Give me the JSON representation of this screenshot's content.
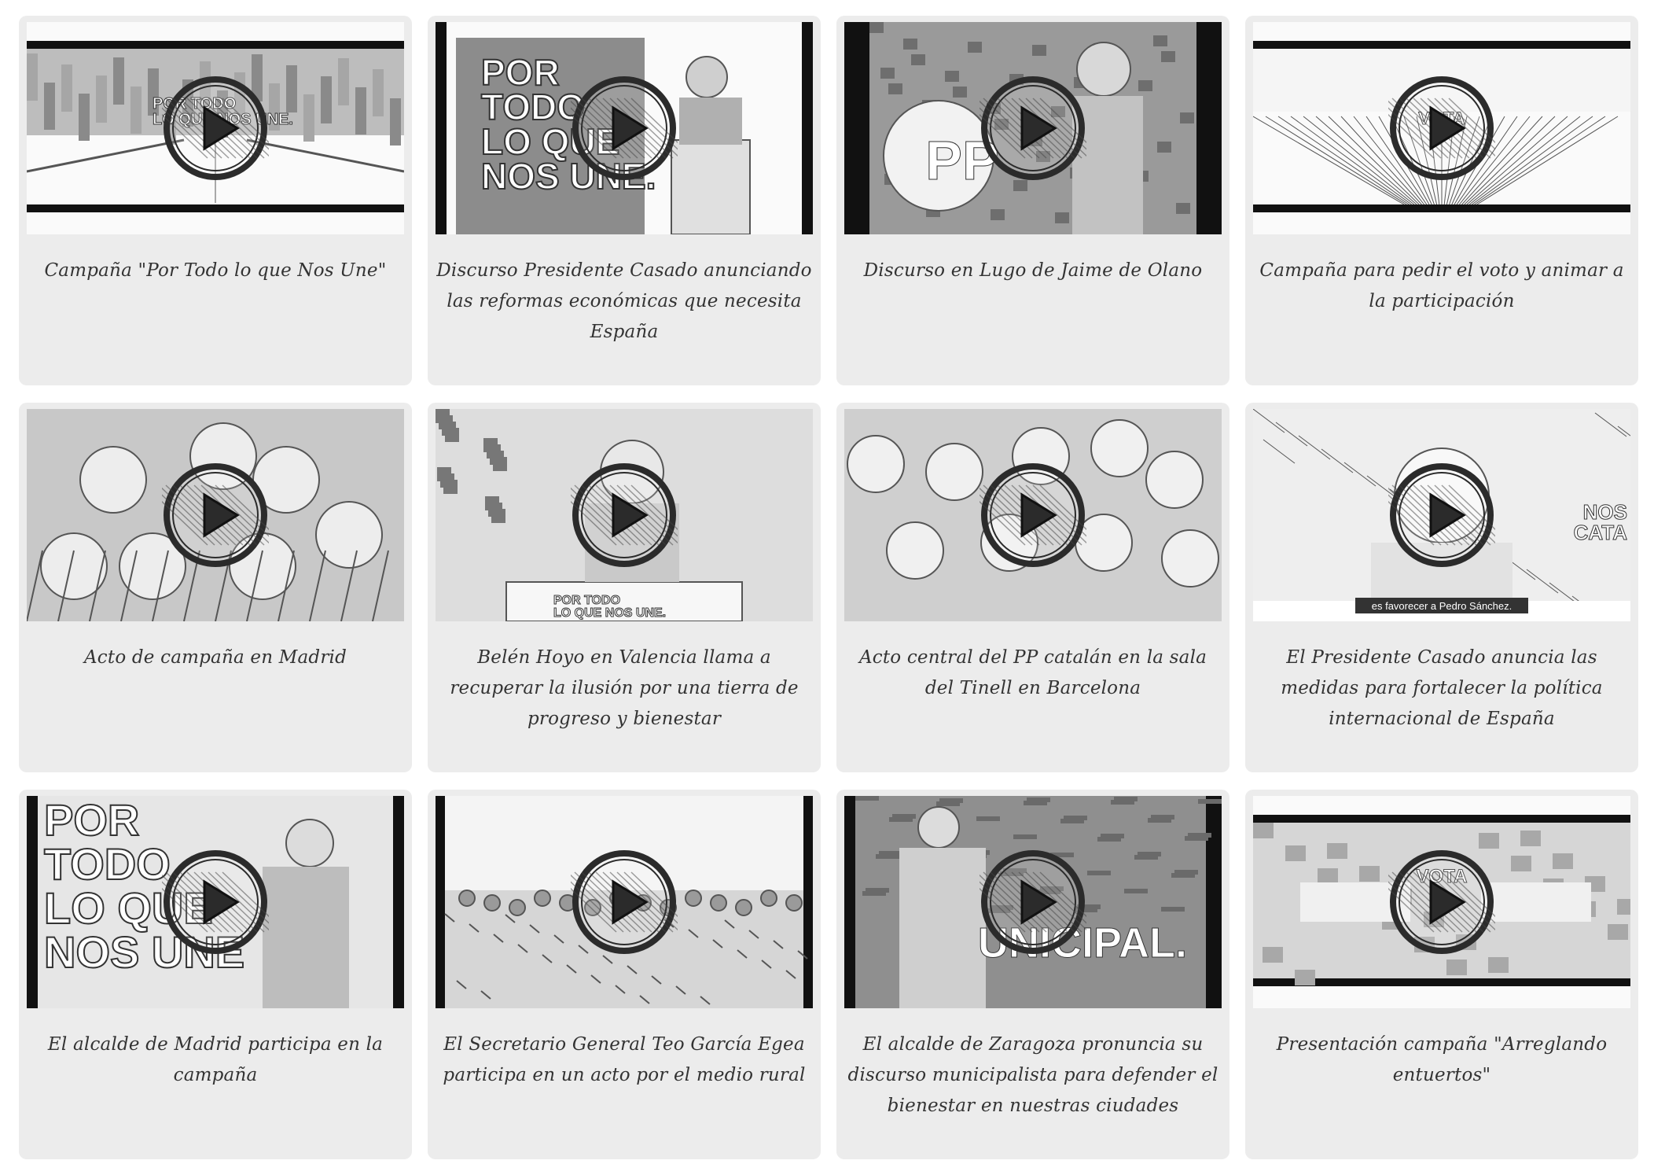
{
  "videos": [
    {
      "caption": "Campaña \"Por Todo lo que Nos Une\"",
      "thumb": "road",
      "overlay": [
        "POR TODO",
        "LO QUE NOS UNE."
      ]
    },
    {
      "caption": "Discurso Presidente Casado anunciando las reformas económicas que necesita España",
      "thumb": "podium",
      "overlay": [
        "POR",
        "TODO",
        "LO QUE",
        "NOS UNE."
      ]
    },
    {
      "caption": "Discurso en Lugo de Jaime de Olano",
      "thumb": "speaker-pp",
      "overlay": [
        "PP"
      ]
    },
    {
      "caption": "Campaña para pedir el voto y animar a la participación",
      "thumb": "field",
      "overlay": [
        "VOTA"
      ]
    },
    {
      "caption": "Acto de campaña en Madrid",
      "thumb": "crowd",
      "overlay": []
    },
    {
      "caption": "Belén Hoyo en Valencia llama a recuperar la ilusión por una tierra de progreso y bienestar",
      "thumb": "lectern",
      "overlay": [
        "POR TODO",
        "LO QUE NOS UNE."
      ]
    },
    {
      "caption": "Acto central del PP catalán en la sala del Tinell en Barcelona",
      "thumb": "audience",
      "overlay": []
    },
    {
      "caption": "El Presidente Casado anuncia las medidas para fortalecer la política internacional de España",
      "thumb": "portrait",
      "overlay": [
        "NOS",
        "CATA"
      ],
      "subtitle": "es favorecer a Pedro Sánchez."
    },
    {
      "caption": "El alcalde de Madrid participa en la campaña",
      "thumb": "mayor",
      "overlay": [
        "POR",
        "TODO",
        "LO QUE",
        "NOS UNE"
      ]
    },
    {
      "caption": "El Secretario General Teo García Egea participa en un acto por el medio rural",
      "thumb": "vineyard",
      "overlay": []
    },
    {
      "caption": "El alcalde de Zaragoza pronuncia su discurso municipalista para defender el bienestar en nuestras ciudades",
      "thumb": "stage",
      "overlay": [
        "UNICIPAL."
      ]
    },
    {
      "caption": "Presentación campaña \"Arreglando entuertos\"",
      "thumb": "hands",
      "overlay": [
        "VOTA"
      ]
    }
  ]
}
